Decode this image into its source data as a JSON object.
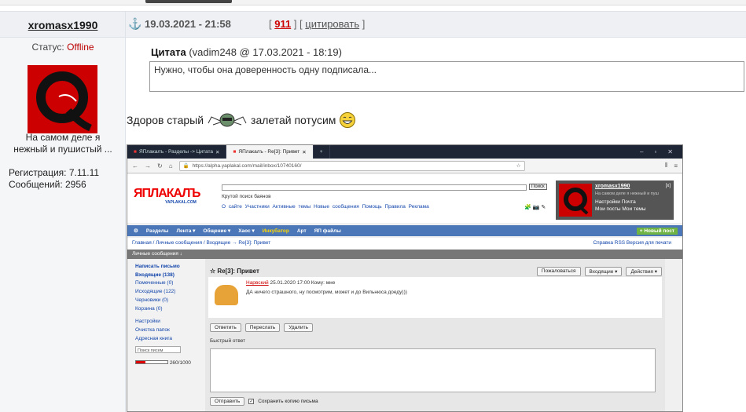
{
  "post": {
    "username": "xromasx1990",
    "date": "19.03.2021 - 21:58",
    "post_number": "911",
    "quote_link": "цитировать",
    "status_label": "Статус:",
    "status_value": "Offline",
    "slogan_line1": "На самом деле я",
    "slogan_line2": "нежный и пушистый ...",
    "registration": "Регистрация: 7.11.11",
    "messages": "Сообщений: 2956"
  },
  "quote": {
    "label": "Цитата",
    "source": "(vadim248 @ 17.03.2021 - 18:19)",
    "text": "Нужно, чтобы она доверенность одну подписала..."
  },
  "message": {
    "part1": "Здоров старый",
    "part2": "залетай потусим"
  },
  "screenshot": {
    "tabs": [
      {
        "label": "ЯПлакалъ - Разделы -> Цитата"
      },
      {
        "label": "ЯПлакалъ - Re[3]: Привет"
      }
    ],
    "new_tab": "+",
    "url": "https://alpha.yaplakal.com/mail/inbox/10740160/",
    "logo": "ЯПЛАКАЛЪ",
    "logo_sub": "YAPLAKAL.COM",
    "search_button": "Поиск",
    "search_hint": "Крутой поиск баянов",
    "site_links": "О сайте  Участники  Активные темы  Новые сообщения  Помощь  Правила  Реклама",
    "profile": {
      "name": "xromasx1990",
      "subtitle": "На самом деле я нежный и пуш",
      "close": "[x]",
      "link1": "Настройки     Почта",
      "link2": "Мои посты     Мои темы"
    },
    "menu": [
      "Разделы",
      "Лента ▾",
      "Общение ▾",
      "Хаос ▾"
    ],
    "menu_highlight": "Инкубатор",
    "menu_more": [
      "Арт",
      "ЯП файлы"
    ],
    "menu_new_post": "+ Новый пост",
    "breadcrumb": "Главная / Личные сообщения / Входящие → Re[3]: Привет",
    "breadcrumb_right": "Справка  RSS  Версия для печати",
    "box_title": "Личные сообщения ↓",
    "sidebar": [
      {
        "label": "Написать письмо",
        "bold": true
      },
      {
        "label": "Входящие (138)",
        "bold": true
      },
      {
        "label": "Помеченные (0)"
      },
      {
        "label": "Исходящие (122)"
      },
      {
        "label": "Черновики (0)"
      },
      {
        "label": "Корзина (0)"
      },
      {
        "label": ""
      },
      {
        "label": "Настройки"
      },
      {
        "label": "Очистка папок"
      },
      {
        "label": "Адресная книга"
      }
    ],
    "search_placeholder": "Поиск писем",
    "quota": "260/1000",
    "subject": "Re[3]: Привет",
    "buttons": [
      "Пожаловаться",
      "Входящие ▾",
      "Действия ▾"
    ],
    "from_name": "Нарвский",
    "from_meta": "25.01.2020 17:00 Кому: мне",
    "body": "ДА ничего страшного, ну посмотрим, может и до Вильнюса доеду)))",
    "actions": [
      "Ответить",
      "Переслать",
      "Удалить"
    ],
    "quick_reply": "Быстрый ответ",
    "send": "Отправить",
    "save_copy": "Сохранить копию письма"
  }
}
